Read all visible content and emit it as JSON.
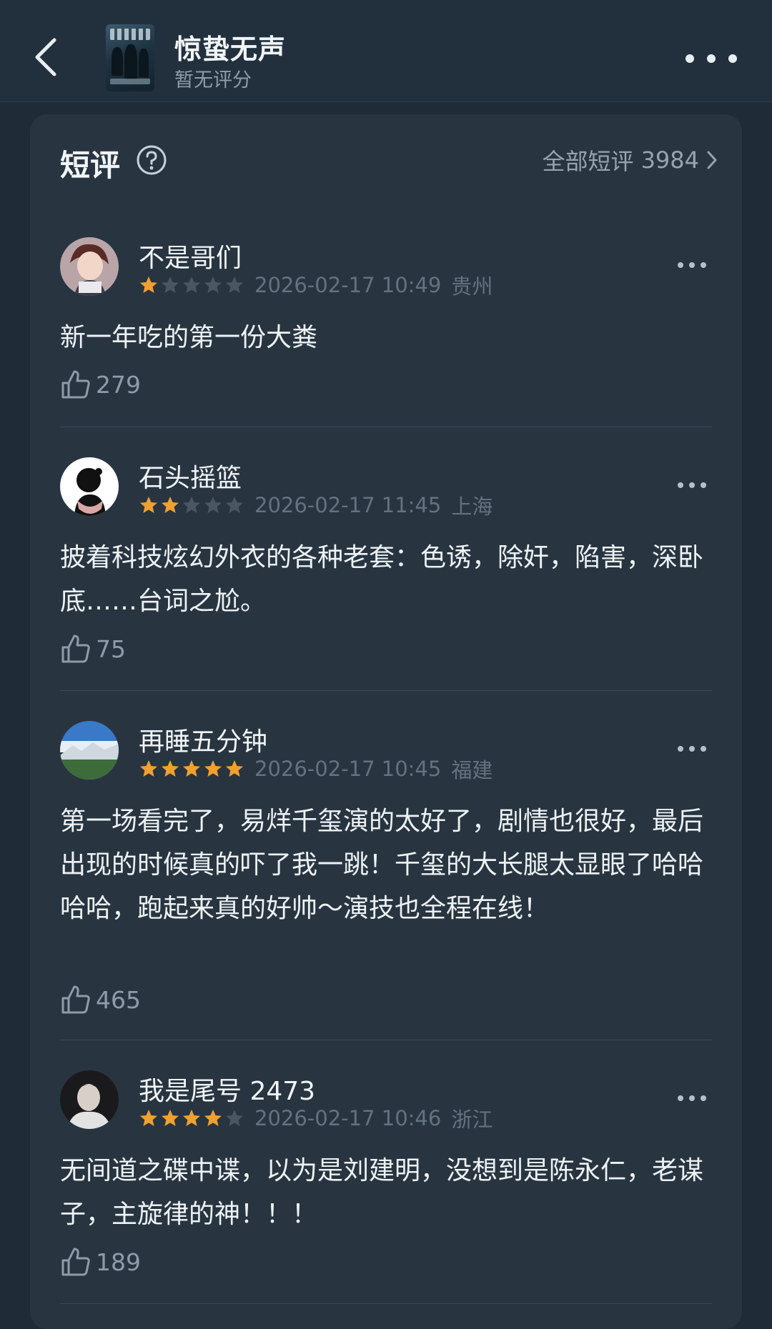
{
  "header": {
    "title": "惊蛰无声",
    "subtitle": "暂无评分"
  },
  "section": {
    "title": "短评",
    "all_label": "全部短评",
    "total_count": "3984"
  },
  "colors": {
    "star_filled": "#f0a030",
    "star_empty": "#4a5662",
    "background": "#1f2b37",
    "card": "#283541"
  },
  "reviews": [
    {
      "username": "不是哥们",
      "rating": 1,
      "date": "2026-02-17 10:49",
      "location": "贵州",
      "content": "新一年吃的第一份大粪",
      "likes": "279"
    },
    {
      "username": "石头摇篮",
      "rating": 2,
      "date": "2026-02-17 11:45",
      "location": "上海",
      "content": "披着科技炫幻外衣的各种老套：色诱，除奸，陷害，深卧底……台词之尬。",
      "likes": "75"
    },
    {
      "username": "再睡五分钟",
      "rating": 5,
      "date": "2026-02-17 10:45",
      "location": "福建",
      "content": "第一场看完了，易烊千玺演的太好了，剧情也很好，最后出现的时候真的吓了我一跳！千玺的大长腿太显眼了哈哈哈哈，跑起来真的好帅～演技也全程在线！",
      "likes": "465"
    },
    {
      "username": "我是尾号 2473",
      "rating": 4,
      "date": "2026-02-17 10:46",
      "location": "浙江",
      "content": "无间道之碟中谍，以为是刘建明，没想到是陈永仁，老谋子，主旋律的神！！！",
      "likes": "189"
    }
  ]
}
